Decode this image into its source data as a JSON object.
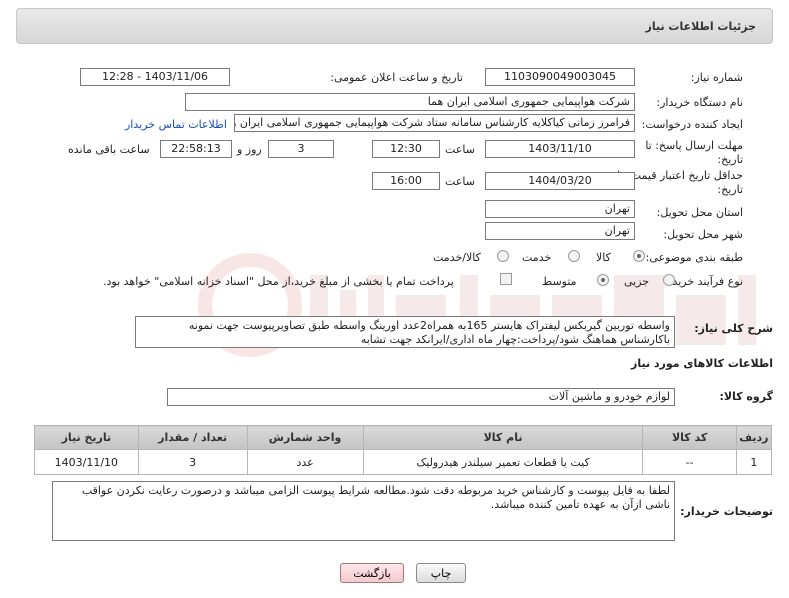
{
  "header": {
    "title": "جزئیات اطلاعات نیاز"
  },
  "fields": {
    "need_number_label": "شماره نیاز:",
    "need_number": "1103090049003045",
    "announce_label": "تاریخ و ساعت اعلان عمومی:",
    "announce_value": "1403/11/06 - 12:28",
    "buyer_org_label": "نام دستگاه خریدار:",
    "buyer_org": "شرکت هواپیمایی جمهوری اسلامی ایران هما",
    "creator_label": "ایجاد کننده درخواست:",
    "creator": "فرامرز زمانی کیاکلایه کارشناس سامانه ستاد شرکت هواپیمایی جمهوری اسلامی ایران هما",
    "buyer_contact_link": "اطلاعات تماس خریدار",
    "deadline_label_1": "مهلت ارسال پاسخ: تا",
    "deadline_label_2": "تاریخ:",
    "deadline_date": "1403/11/10",
    "time_label": "ساعت",
    "deadline_time": "12:30",
    "days_value": "3",
    "days_label": "روز و",
    "remaining_time": "22:58:13",
    "remaining_label": "ساعت باقی مانده",
    "validity_label_1": "حداقل تاریخ اعتبار قیمت: تا",
    "validity_label_2": "تاریخ:",
    "validity_date": "1404/03/20",
    "validity_time_label": "ساعت",
    "validity_time": "16:00",
    "province_label": "استان محل تحویل:",
    "province": "تهران",
    "city_label": "شهر محل تحویل:",
    "city": "تهران",
    "category_label": "طبقه بندی موضوعی:",
    "category_options": [
      "کالا",
      "خدمت",
      "کالا/خدمت"
    ],
    "process_label": "نوع فرآیند خرید :",
    "process_options": [
      "جزیی",
      "متوسط"
    ],
    "payment_note": "پرداخت تمام یا بخشی از مبلغ خرید،از محل \"اسناد خزانه اسلامی\" خواهد بود."
  },
  "description": {
    "label": "شرح کلی نیاز:",
    "text": "واسطه توربین گیربکس لیفتراک هایستر 165به همراه2عدد اورینگ واسطه طبق تصاویرپیوست جهت نمونه باکارشناس هماهنگ شود/پرداخت:چهار ماه اداری/ایرانکد جهت تشابه"
  },
  "goods_section": {
    "title": "اطلاعات کالاهای مورد نیاز",
    "group_label": "گروه کالا:",
    "group_value": "لوازم خودرو و ماشین آلات"
  },
  "table": {
    "headers": [
      "ردیف",
      "کد کالا",
      "نام کالا",
      "واحد شمارش",
      "تعداد / مقدار",
      "تاریخ نیاز"
    ],
    "rows": [
      [
        "1",
        "--",
        "کیت یا قطعات تعمیر سیلندر هیدرولیک",
        "عدد",
        "3",
        "1403/11/10"
      ]
    ]
  },
  "buyer_notes": {
    "label": "توضیحات خریدار:",
    "text": "لطفا به فایل پیوست و کارشناس خرید مربوطه دقت شود.مطالعه شرایط پیوست الزامی میباشد و درصورت رعایت نکردن عواقب ناشی ازآن به عهده تامین کننده میباشد."
  },
  "buttons": {
    "print": "چاپ",
    "back": "بازگشت"
  },
  "colors": {
    "link": "#1a4fb5",
    "header_bg": "#dcdcdc",
    "border": "#7a7a7a"
  }
}
